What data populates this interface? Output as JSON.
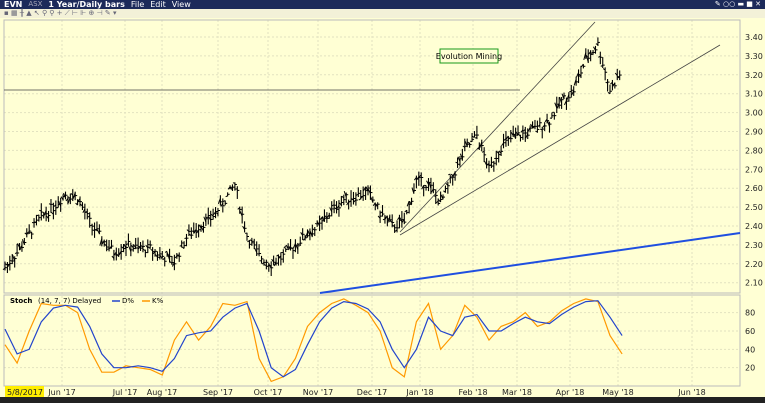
{
  "titlebar": {
    "symbol": "EVN",
    "exchange": "ASX",
    "period": "1 Year/Daily bars",
    "menu": [
      "File",
      "Edit",
      "View"
    ]
  },
  "toolbar": {
    "icons": [
      "settings-icon",
      "bar-type-icon",
      "chart-type-icon",
      "draw-icon",
      "zoom-in-icon",
      "zoom-out-icon",
      "crosshair-icon",
      "trendline-icon",
      "tool-icon",
      "tool2-icon",
      "tool3-icon",
      "tool4-icon",
      "more-icon"
    ]
  },
  "annotation": "Evolution Mining",
  "stoch": {
    "label": "Stoch",
    "params": "(14, 7, 7) Delayed",
    "d_label": "D%",
    "k_label": "K%",
    "d_color": "#2244cc",
    "k_color": "#ff9900"
  },
  "chart_data": {
    "type": "line",
    "title": "EVN ASX 1 Year/Daily bars",
    "start_date": "5/8/2017",
    "x_ticks": [
      "Jun '17",
      "Jul '17",
      "Aug '17",
      "Sep '17",
      "Oct '17",
      "Nov '17",
      "Dec '17",
      "Jan '18",
      "Feb '18",
      "Mar '18",
      "Apr '18",
      "May '18",
      "Jun '18"
    ],
    "price_ticks": [
      "3.40",
      "3.30",
      "3.20",
      "3.10",
      "3.00",
      "2.90",
      "2.80",
      "2.70",
      "2.60",
      "2.50",
      "2.40",
      "2.30",
      "2.20",
      "2.10"
    ],
    "ylim": [
      2.05,
      3.45
    ],
    "weekly_close": [
      2.18,
      2.26,
      2.36,
      2.45,
      2.5,
      2.57,
      2.55,
      2.42,
      2.33,
      2.26,
      2.3,
      2.28,
      2.28,
      2.24,
      2.21,
      2.34,
      2.4,
      2.44,
      2.52,
      2.62,
      2.35,
      2.24,
      2.2,
      2.24,
      2.3,
      2.36,
      2.4,
      2.48,
      2.54,
      2.56,
      2.58,
      2.47,
      2.4,
      2.42,
      2.64,
      2.62,
      2.52,
      2.66,
      2.8,
      2.88,
      2.7,
      2.82,
      2.87,
      2.89,
      2.92,
      2.96,
      3.06,
      3.12,
      3.28,
      3.36,
      3.12,
      3.22
    ],
    "stoch_ticks": [
      "80",
      "60",
      "40",
      "20"
    ],
    "stoch_k": [
      45,
      25,
      60,
      90,
      88,
      88,
      80,
      40,
      15,
      15,
      22,
      20,
      18,
      12,
      50,
      70,
      50,
      65,
      90,
      88,
      92,
      30,
      5,
      10,
      30,
      65,
      80,
      90,
      95,
      88,
      80,
      60,
      20,
      10,
      70,
      90,
      40,
      55,
      88,
      75,
      50,
      65,
      70,
      80,
      65,
      70,
      82,
      90,
      95,
      92,
      55,
      35
    ],
    "stoch_d": [
      62,
      35,
      40,
      70,
      85,
      88,
      86,
      65,
      35,
      20,
      20,
      22,
      20,
      16,
      30,
      55,
      58,
      60,
      75,
      85,
      90,
      60,
      20,
      10,
      18,
      45,
      70,
      85,
      92,
      90,
      84,
      70,
      40,
      20,
      40,
      75,
      60,
      55,
      75,
      78,
      60,
      60,
      68,
      75,
      70,
      68,
      78,
      86,
      92,
      93,
      75,
      55
    ]
  }
}
